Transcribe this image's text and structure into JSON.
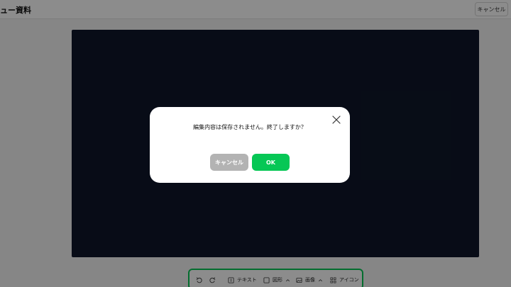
{
  "header": {
    "title": "ュー資料",
    "cancel_label": "キャンセル"
  },
  "toolbar": {
    "text_label": "テキスト",
    "shape_label": "図形",
    "image_label": "画像",
    "icon_label": "アイコン"
  },
  "dialog": {
    "message": "編集内容は保存されません。終了しますか？",
    "cancel_label": "キャンセル",
    "ok_label": "OK"
  },
  "colors": {
    "accent": "#06c755",
    "canvas": "#0f172a",
    "cancel_button": "#b3b3b3"
  },
  "icons": [
    "undo-icon",
    "redo-icon",
    "text-icon",
    "shape-icon",
    "chevron-up-icon",
    "image-icon",
    "icon-grid-icon",
    "close-icon"
  ]
}
